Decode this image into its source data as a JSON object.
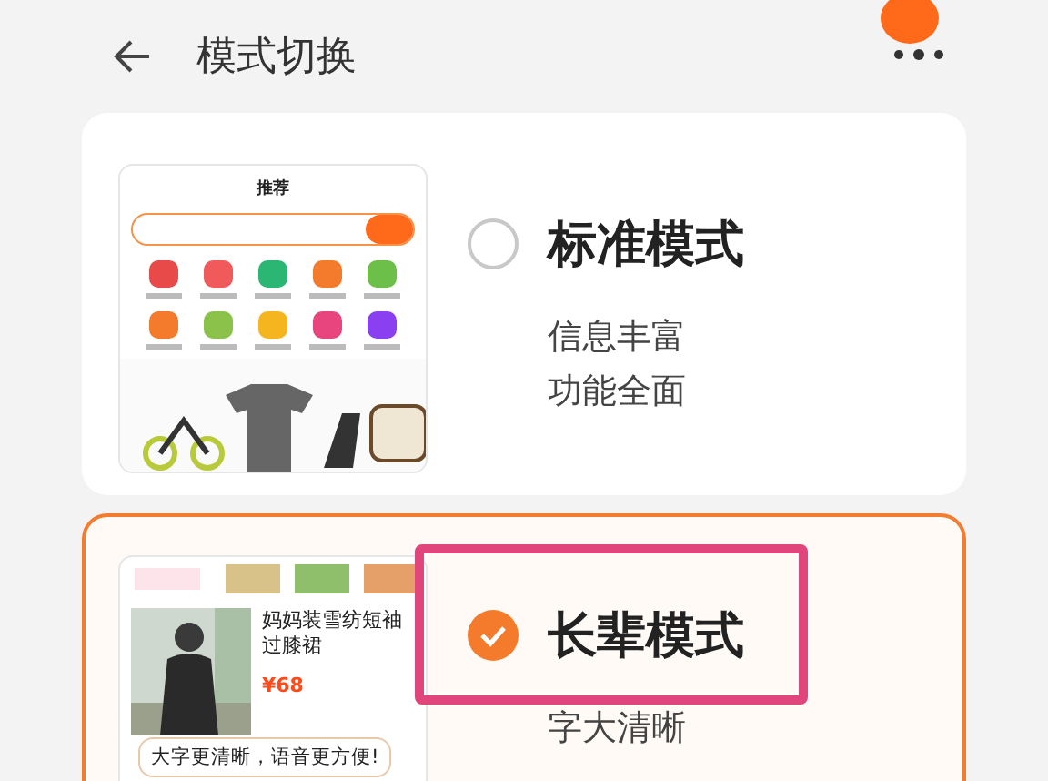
{
  "header": {
    "title": "模式切换"
  },
  "modes": [
    {
      "title": "标准模式",
      "lines": [
        "信息丰富",
        "功能全面"
      ],
      "selected": false,
      "highlighted": false,
      "preview": {
        "kind": "standard",
        "tab": "推荐"
      }
    },
    {
      "title": "长辈模式",
      "lines": [
        "字大清晰"
      ],
      "selected": true,
      "highlighted": true,
      "preview": {
        "kind": "elder",
        "product": "妈妈装雪纺短袖过膝裙",
        "price": "¥68",
        "tip": "大字更清晰，语音更方便!"
      }
    }
  ]
}
